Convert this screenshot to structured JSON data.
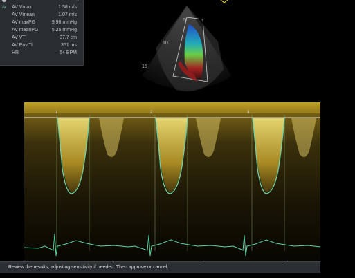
{
  "measurements": {
    "rows": [
      {
        "label": "AV Vmax",
        "value": "1.58 m/s"
      },
      {
        "label": "AV Vmean",
        "value": "1.07 m/s"
      },
      {
        "label": "AV maxPG",
        "value": "9.96 mmHg"
      },
      {
        "label": "AV meanPG",
        "value": "5.25 mmHg"
      },
      {
        "label": "AV VTI",
        "value": "37.7 cm"
      },
      {
        "label": "AV Env.Ti",
        "value": "351 ms"
      },
      {
        "label": "HR",
        "value": "54 BPM"
      }
    ],
    "active_indicator": "Ar"
  },
  "image": {
    "depth_labels": [
      "5",
      "10",
      "15"
    ]
  },
  "doppler": {
    "time_labels": [
      "-4",
      "-3",
      "-2",
      "-1"
    ],
    "cycle_markers": [
      "1",
      "2",
      "3"
    ],
    "colors": {
      "spectrum": "#d8c23a",
      "trace": "#6fd3a8",
      "ecg": "#5fd6a0"
    }
  },
  "status": {
    "message": "Review the results, adjusting sensitivity if needed. Then approve or cancel."
  }
}
